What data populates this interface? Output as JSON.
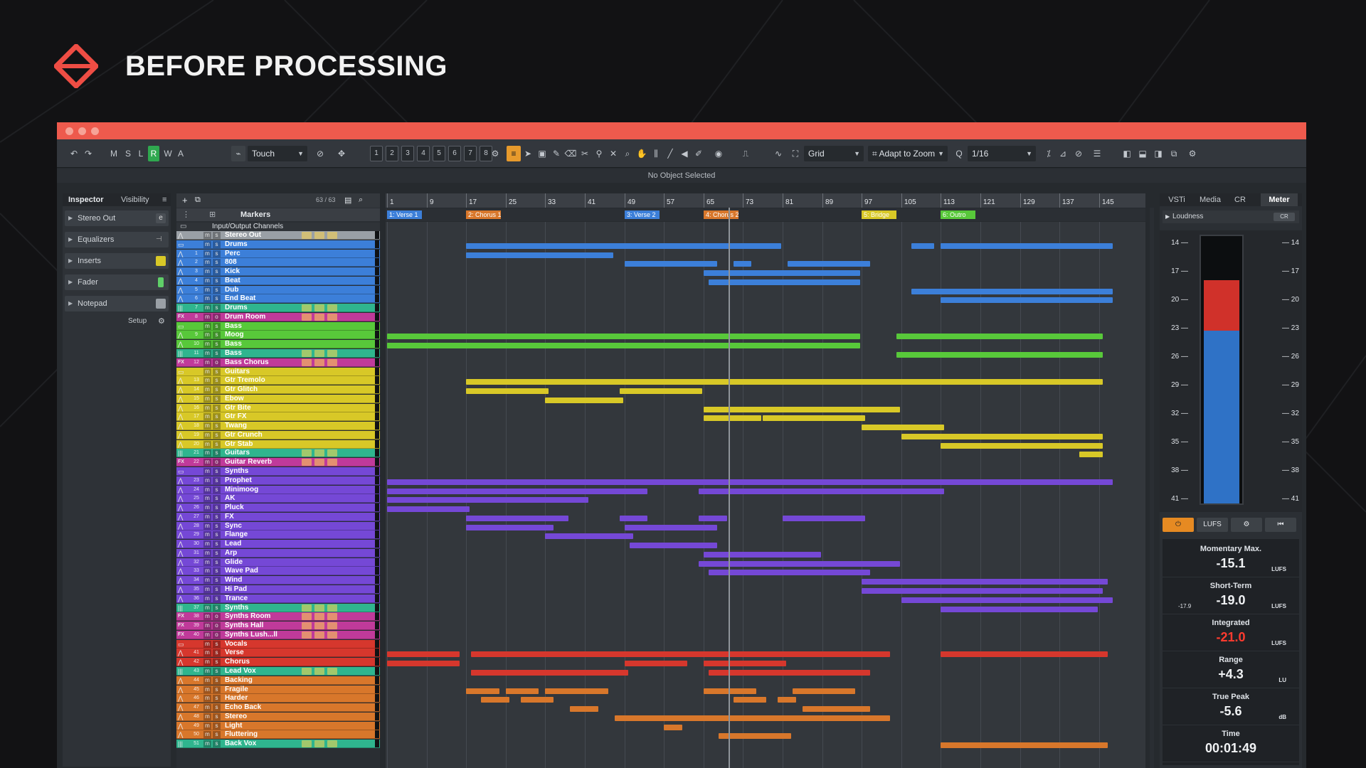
{
  "header": {
    "title": "BEFORE PROCESSING"
  },
  "colors": {
    "accent": "#ee5a4d",
    "drums": "#3c7fd9",
    "bass": "#58c83a",
    "guitars": "#d8c827",
    "synths": "#7548d6",
    "vocals": "#d6372d",
    "backing": "#d8772b",
    "fx": "#c03a9a"
  },
  "toolbar": {
    "buttons": [
      "M",
      "S",
      "L",
      "R",
      "W",
      "A"
    ],
    "automation_mode": "Touch",
    "locators": [
      "1",
      "2",
      "3",
      "4",
      "5",
      "6",
      "7",
      "8"
    ],
    "snap_type": "Grid",
    "grid_mode": "Adapt to Zoom",
    "quantize": "1/16"
  },
  "info_line": "No Object Selected",
  "inspector": {
    "tabs": [
      "Inspector",
      "Visibility"
    ],
    "channel": "Stereo Out",
    "sections": [
      "Equalizers",
      "Inserts",
      "Fader",
      "Notepad"
    ],
    "setup_label": "Setup"
  },
  "tracklist": {
    "count": "63 / 63",
    "marker_track": "Markers",
    "io_folder": "Input/Output Channels",
    "tracks": [
      {
        "name": "Stereo Out",
        "num": "",
        "type": "out",
        "color": "#9aa0a6"
      },
      {
        "name": "Drums",
        "num": "",
        "type": "folder",
        "color": "#3c7fd9"
      },
      {
        "name": "Perc",
        "num": "1",
        "type": "audio",
        "color": "#3c7fd9"
      },
      {
        "name": "808",
        "num": "2",
        "type": "audio",
        "color": "#3c7fd9"
      },
      {
        "name": "Kick",
        "num": "3",
        "type": "audio",
        "color": "#3c7fd9"
      },
      {
        "name": "Beat",
        "num": "4",
        "type": "audio",
        "color": "#3c7fd9"
      },
      {
        "name": "Dub",
        "num": "5",
        "type": "audio",
        "color": "#3c7fd9"
      },
      {
        "name": "End Beat",
        "num": "6",
        "type": "audio",
        "color": "#3c7fd9"
      },
      {
        "name": "Drums",
        "num": "7",
        "type": "group",
        "color": "#2fb58e"
      },
      {
        "name": "Drum Room",
        "num": "8",
        "type": "fx",
        "color": "#c03a9a"
      },
      {
        "name": "Bass",
        "num": "",
        "type": "folder",
        "color": "#58c83a"
      },
      {
        "name": "Moog",
        "num": "9",
        "type": "audio",
        "color": "#58c83a"
      },
      {
        "name": "Bass",
        "num": "10",
        "type": "audio",
        "color": "#58c83a"
      },
      {
        "name": "Bass",
        "num": "11",
        "type": "group",
        "color": "#2fb58e"
      },
      {
        "name": "Bass Chorus",
        "num": "12",
        "type": "fx",
        "color": "#c03a9a"
      },
      {
        "name": "Guitars",
        "num": "",
        "type": "folder",
        "color": "#d8c827"
      },
      {
        "name": "Gtr Tremolo",
        "num": "13",
        "type": "audio",
        "color": "#d8c827"
      },
      {
        "name": "Gtr Glitch",
        "num": "14",
        "type": "audio",
        "color": "#d8c827"
      },
      {
        "name": "Ebow",
        "num": "15",
        "type": "audio",
        "color": "#d8c827"
      },
      {
        "name": "Gtr Bite",
        "num": "16",
        "type": "audio",
        "color": "#d8c827"
      },
      {
        "name": "Gtr FX",
        "num": "17",
        "type": "audio",
        "color": "#d8c827"
      },
      {
        "name": "Twang",
        "num": "18",
        "type": "audio",
        "color": "#d8c827"
      },
      {
        "name": "Gtr Crunch",
        "num": "19",
        "type": "audio",
        "color": "#d8c827"
      },
      {
        "name": "Gtr Stab",
        "num": "20",
        "type": "audio",
        "color": "#d8c827"
      },
      {
        "name": "Guitars",
        "num": "21",
        "type": "group",
        "color": "#2fb58e"
      },
      {
        "name": "Guitar Reverb",
        "num": "22",
        "type": "fx",
        "color": "#c03a9a"
      },
      {
        "name": "Synths",
        "num": "",
        "type": "folder",
        "color": "#7548d6"
      },
      {
        "name": "Prophet",
        "num": "23",
        "type": "audio",
        "color": "#7548d6"
      },
      {
        "name": "Minimoog",
        "num": "24",
        "type": "audio",
        "color": "#7548d6"
      },
      {
        "name": "AK",
        "num": "25",
        "type": "audio",
        "color": "#7548d6"
      },
      {
        "name": "Pluck",
        "num": "26",
        "type": "audio",
        "color": "#7548d6"
      },
      {
        "name": "FX",
        "num": "27",
        "type": "audio",
        "color": "#7548d6"
      },
      {
        "name": "Sync",
        "num": "28",
        "type": "audio",
        "color": "#7548d6"
      },
      {
        "name": "Flange",
        "num": "29",
        "type": "audio",
        "color": "#7548d6"
      },
      {
        "name": "Lead",
        "num": "30",
        "type": "audio",
        "color": "#7548d6"
      },
      {
        "name": "Arp",
        "num": "31",
        "type": "audio",
        "color": "#7548d6"
      },
      {
        "name": "Glide",
        "num": "32",
        "type": "audio",
        "color": "#7548d6"
      },
      {
        "name": "Wave Pad",
        "num": "33",
        "type": "audio",
        "color": "#7548d6"
      },
      {
        "name": "Wind",
        "num": "34",
        "type": "audio",
        "color": "#7548d6"
      },
      {
        "name": "Hi Pad",
        "num": "35",
        "type": "audio",
        "color": "#7548d6"
      },
      {
        "name": "Trance",
        "num": "36",
        "type": "audio",
        "color": "#7548d6"
      },
      {
        "name": "Synths",
        "num": "37",
        "type": "group",
        "color": "#2fb58e"
      },
      {
        "name": "Synths Room",
        "num": "38",
        "type": "fx",
        "color": "#c03a9a"
      },
      {
        "name": "Synths Hall",
        "num": "39",
        "type": "fx",
        "color": "#c03a9a"
      },
      {
        "name": "Synths Lush...ll",
        "num": "40",
        "type": "fx",
        "color": "#c03a9a"
      },
      {
        "name": "Vocals",
        "num": "",
        "type": "folder",
        "color": "#d6372d"
      },
      {
        "name": "Verse",
        "num": "41",
        "type": "audio",
        "color": "#d6372d"
      },
      {
        "name": "Chorus",
        "num": "42",
        "type": "audio",
        "color": "#d6372d"
      },
      {
        "name": "Lead Vox",
        "num": "43",
        "type": "group",
        "color": "#2fb58e"
      },
      {
        "name": "Backing",
        "num": "44",
        "type": "audio",
        "color": "#d8772b"
      },
      {
        "name": "Fragile",
        "num": "45",
        "type": "audio",
        "color": "#d8772b"
      },
      {
        "name": "Harder",
        "num": "46",
        "type": "audio",
        "color": "#d8772b"
      },
      {
        "name": "Echo Back",
        "num": "47",
        "type": "audio",
        "color": "#d8772b"
      },
      {
        "name": "Stereo",
        "num": "48",
        "type": "audio",
        "color": "#d8772b"
      },
      {
        "name": "Light",
        "num": "49",
        "type": "audio",
        "color": "#d8772b"
      },
      {
        "name": "Fluttering",
        "num": "50",
        "type": "audio",
        "color": "#d8772b"
      },
      {
        "name": "Back Vox",
        "num": "51",
        "type": "group",
        "color": "#2fb58e"
      }
    ]
  },
  "ruler": {
    "bars": [
      "1",
      "9",
      "17",
      "25",
      "33",
      "41",
      "49",
      "57",
      "65",
      "73",
      "81",
      "89",
      "97",
      "105",
      "113",
      "121",
      "129",
      "137",
      "145"
    ]
  },
  "markers": [
    {
      "label": "1: Verse 1",
      "bar": 1,
      "color": "#3c7fd9"
    },
    {
      "label": "2: Chorus 1",
      "bar": 17,
      "color": "#d8772b"
    },
    {
      "label": "3: Verse 2",
      "bar": 49,
      "color": "#3c7fd9"
    },
    {
      "label": "4: Chorus 2",
      "bar": 65,
      "color": "#d8772b"
    },
    {
      "label": "5: Bridge",
      "bar": 97,
      "color": "#d8c827"
    },
    {
      "label": "6: Outro",
      "bar": 113,
      "color": "#58c83a"
    }
  ],
  "playhead_bar": 70,
  "parts": [
    [
      1,
      17,
      81,
      "#3c7fd9"
    ],
    [
      1,
      107,
      112,
      "#3c7fd9"
    ],
    [
      1,
      113,
      148,
      "#3c7fd9"
    ],
    [
      2,
      17,
      47,
      "#3c7fd9"
    ],
    [
      3,
      49,
      68,
      "#3c7fd9"
    ],
    [
      3,
      71,
      75,
      "#3c7fd9"
    ],
    [
      3,
      82,
      99,
      "#3c7fd9"
    ],
    [
      4,
      65,
      97,
      "#3c7fd9"
    ],
    [
      5,
      66,
      97,
      "#3c7fd9"
    ],
    [
      6,
      107,
      148,
      "#3c7fd9"
    ],
    [
      7,
      113,
      148,
      "#3c7fd9"
    ],
    [
      11,
      1,
      97,
      "#58c83a"
    ],
    [
      11,
      104,
      146,
      "#58c83a"
    ],
    [
      12,
      1,
      97,
      "#58c83a"
    ],
    [
      13,
      104,
      146,
      "#58c83a"
    ],
    [
      16,
      17,
      146,
      "#d8c827"
    ],
    [
      17,
      17,
      34,
      "#d8c827"
    ],
    [
      17,
      48,
      65,
      "#d8c827"
    ],
    [
      18,
      33,
      49,
      "#d8c827"
    ],
    [
      19,
      65,
      105,
      "#d8c827"
    ],
    [
      20,
      65,
      77,
      "#d8c827"
    ],
    [
      20,
      77,
      98,
      "#d8c827"
    ],
    [
      21,
      97,
      114,
      "#d8c827"
    ],
    [
      22,
      105,
      146,
      "#d8c827"
    ],
    [
      23,
      113,
      146,
      "#d8c827"
    ],
    [
      24,
      141,
      146,
      "#d8c827"
    ],
    [
      27,
      1,
      148,
      "#7548d6"
    ],
    [
      28,
      1,
      54,
      "#7548d6"
    ],
    [
      28,
      64,
      114,
      "#7548d6"
    ],
    [
      29,
      1,
      42,
      "#7548d6"
    ],
    [
      30,
      1,
      18,
      "#7548d6"
    ],
    [
      31,
      17,
      38,
      "#7548d6"
    ],
    [
      31,
      48,
      54,
      "#7548d6"
    ],
    [
      31,
      64,
      70,
      "#7548d6"
    ],
    [
      31,
      81,
      98,
      "#7548d6"
    ],
    [
      32,
      17,
      35,
      "#7548d6"
    ],
    [
      32,
      49,
      68,
      "#7548d6"
    ],
    [
      33,
      33,
      51,
      "#7548d6"
    ],
    [
      34,
      50,
      68,
      "#7548d6"
    ],
    [
      35,
      65,
      89,
      "#7548d6"
    ],
    [
      36,
      64,
      105,
      "#7548d6"
    ],
    [
      37,
      66,
      99,
      "#7548d6"
    ],
    [
      38,
      97,
      147,
      "#7548d6"
    ],
    [
      39,
      97,
      146,
      "#7548d6"
    ],
    [
      40,
      105,
      148,
      "#7548d6"
    ],
    [
      41,
      113,
      145,
      "#7548d6"
    ],
    [
      46,
      1,
      16,
      "#d6372d"
    ],
    [
      46,
      18,
      103,
      "#d6372d"
    ],
    [
      46,
      113,
      147,
      "#d6372d"
    ],
    [
      47,
      1,
      16,
      "#d6372d"
    ],
    [
      47,
      49,
      62,
      "#d6372d"
    ],
    [
      47,
      65,
      82,
      "#d6372d"
    ],
    [
      48,
      18,
      50,
      "#d6372d"
    ],
    [
      48,
      66,
      99,
      "#d6372d"
    ],
    [
      50,
      17,
      24,
      "#d8772b"
    ],
    [
      50,
      25,
      32,
      "#d8772b"
    ],
    [
      50,
      33,
      46,
      "#d8772b"
    ],
    [
      50,
      65,
      76,
      "#d8772b"
    ],
    [
      50,
      83,
      96,
      "#d8772b"
    ],
    [
      51,
      20,
      26,
      "#d8772b"
    ],
    [
      51,
      28,
      35,
      "#d8772b"
    ],
    [
      51,
      71,
      78,
      "#d8772b"
    ],
    [
      51,
      80,
      84,
      "#d8772b"
    ],
    [
      52,
      38,
      44,
      "#d8772b"
    ],
    [
      52,
      85,
      99,
      "#d8772b"
    ],
    [
      53,
      47,
      103,
      "#d8772b"
    ],
    [
      54,
      57,
      61,
      "#d8772b"
    ],
    [
      55,
      68,
      83,
      "#d8772b"
    ],
    [
      56,
      113,
      147,
      "#d8772b"
    ]
  ],
  "right_zone": {
    "tabs": [
      "VSTi",
      "Media",
      "CR",
      "Meter"
    ],
    "loudness_label": "Loudness",
    "preset": "CR",
    "scale": [
      "14",
      "17",
      "20",
      "23",
      "26",
      "29",
      "32",
      "35",
      "38",
      "41"
    ],
    "meter_level": {
      "top_of_red": 0.16,
      "top_of_blue": 0.35
    },
    "buttons": [
      "LUFS"
    ],
    "stats": [
      {
        "label": "Momentary Max.",
        "value": "-15.1",
        "unit": "LUFS",
        "extra": ""
      },
      {
        "label": "Short-Term",
        "value": "-19.0",
        "unit": "LUFS",
        "extra": "-17.9"
      },
      {
        "label": "Integrated",
        "value": "-21.0",
        "unit": "LUFS",
        "extra": "",
        "red": true
      },
      {
        "label": "Range",
        "value": "+4.3",
        "unit": "LU",
        "extra": ""
      },
      {
        "label": "True Peak",
        "value": "-5.6",
        "unit": "dB",
        "extra": ""
      },
      {
        "label": "Time",
        "value": "00:01:49",
        "unit": "",
        "extra": ""
      }
    ]
  }
}
